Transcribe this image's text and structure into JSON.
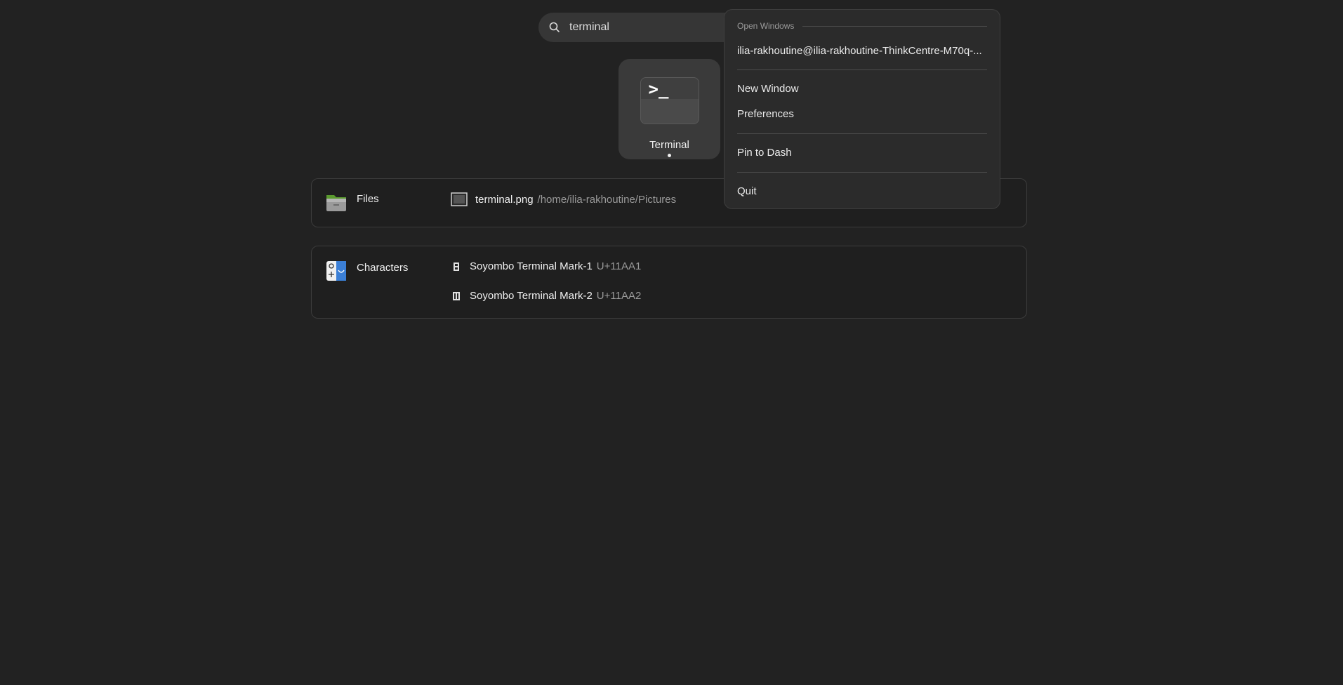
{
  "search": {
    "query": "terminal"
  },
  "app_results": [
    {
      "label": "Terminal",
      "running": true
    }
  ],
  "files_provider": {
    "name": "Files",
    "results": [
      {
        "title": "terminal.png",
        "description": "/home/ilia-rakhoutine/Pictures"
      }
    ]
  },
  "characters_provider": {
    "name": "Characters",
    "results": [
      {
        "glyph": "𑪡",
        "title": "Soyombo Terminal Mark-1",
        "description": "U+11AA1"
      },
      {
        "glyph": "𑪢",
        "title": "Soyombo Terminal Mark-2",
        "description": "U+11AA2"
      }
    ]
  },
  "context_menu": {
    "section_title": "Open Windows",
    "window_item": "ilia-rakhoutine@ilia-rakhoutine-ThinkCentre-M70q-...",
    "new_window": "New Window",
    "preferences": "Preferences",
    "pin_to_dash": "Pin to Dash",
    "quit": "Quit"
  }
}
